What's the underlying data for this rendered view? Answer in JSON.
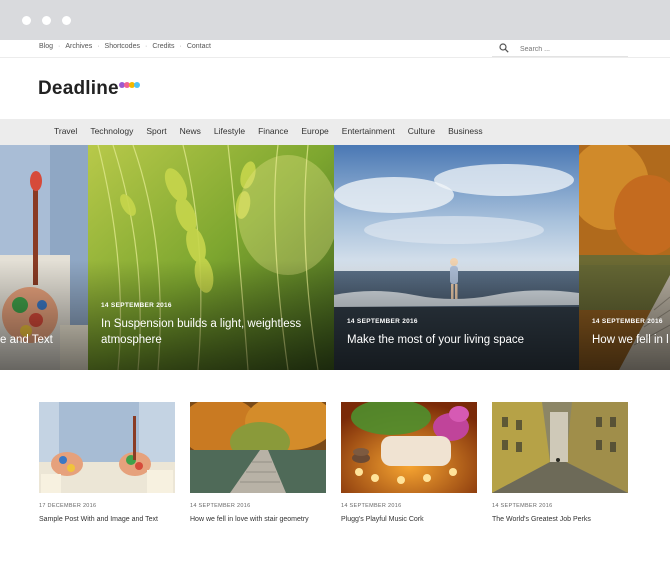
{
  "toplinks": [
    "Blog",
    "Archives",
    "Shortcodes",
    "Credits",
    "Contact"
  ],
  "search": {
    "placeholder": "Search ...",
    "icon": "search-icon"
  },
  "site": {
    "title": "Deadline",
    "logo_dots": [
      "#9b59d0",
      "#f06292",
      "#f5b800",
      "#4fc3f7"
    ]
  },
  "nav": [
    "Travel",
    "Technology",
    "Sport",
    "News",
    "Lifestyle",
    "Finance",
    "Europe",
    "Entertainment",
    "Culture",
    "Business"
  ],
  "slider": [
    {
      "date": "",
      "title": "e and Text"
    },
    {
      "date": "14 SEPTEMBER 2016",
      "title": "In Suspension builds a light, weightless",
      "title2": "atmosphere"
    },
    {
      "date": "14 SEPTEMBER 2016",
      "title": "Make the most of your living space"
    },
    {
      "date": "14 SEPTEMBER 2016",
      "title": "How we fell in l"
    }
  ],
  "posts": [
    {
      "date": "17 DECEMBER 2016",
      "title": "Sample Post With and Image and Text"
    },
    {
      "date": "14 SEPTEMBER 2016",
      "title": "How we fell in love with stair geometry"
    },
    {
      "date": "14 SEPTEMBER 2016",
      "title": "Plugg's Playful Music Cork"
    },
    {
      "date": "14 SEPTEMBER 2016",
      "title": "The World's Greatest Job Perks"
    }
  ]
}
